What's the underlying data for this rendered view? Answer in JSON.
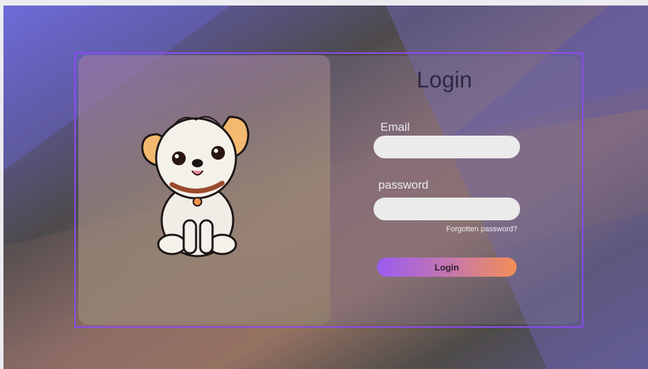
{
  "login": {
    "title": "Login",
    "email_label": "Email",
    "email_value": "",
    "password_label": "password",
    "password_value": "",
    "forgot_link": "Forgotten password?",
    "submit_label": "Login"
  },
  "illustration": {
    "icon": "puppy-illustration"
  },
  "colors": {
    "frame_border": "#8a4cf0",
    "button_gradient_start": "#9a5cf2",
    "button_gradient_end": "#f48e56",
    "title": "#2f2740",
    "input_bg": "#ebebeb"
  }
}
